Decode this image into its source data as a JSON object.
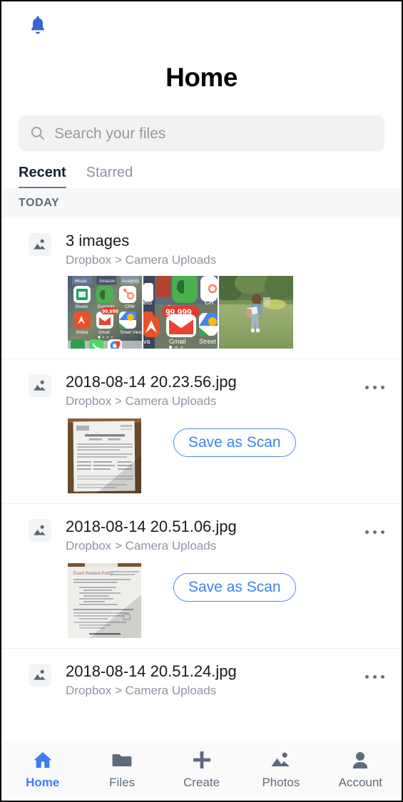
{
  "app": {
    "title": "Home",
    "accent_color": "#3d7df6",
    "muted_text_color": "#8d96a3",
    "section_bg_color": "#F6F8FA"
  },
  "topbar": {
    "notifications_icon": "bell-icon"
  },
  "search": {
    "placeholder": "Search your files",
    "value": "",
    "icon": "search-icon"
  },
  "tabs": [
    {
      "label": "Recent",
      "active": true
    },
    {
      "label": "Starred",
      "active": false
    }
  ],
  "sections": [
    {
      "header": "TODAY",
      "rows": [
        {
          "title": "3 images",
          "path": "Dropbox > Camera Uploads",
          "icon": "image-file-icon",
          "has_overflow": false,
          "thumbnails": [
            "phone-home-screen-screenshot",
            "phone-home-screen-zoom-screenshot",
            "person-standing-on-grass-photo"
          ],
          "action_label": null
        },
        {
          "title": "2018-08-14 20.23.56.jpg",
          "path": "Dropbox > Camera Uploads",
          "icon": "image-file-icon",
          "has_overflow": true,
          "thumbnails": [
            "document-form-on-wood-table-photo"
          ],
          "action_label": "Save as Scan"
        },
        {
          "title": "2018-08-14 20.51.06.jpg",
          "path": "Dropbox > Camera Uploads",
          "icon": "image-file-icon",
          "has_overflow": true,
          "thumbnails": [
            "document-page-photo"
          ],
          "action_label": "Save as Scan"
        },
        {
          "title": "2018-08-14 20.51.24.jpg",
          "path": "Dropbox > Camera Uploads",
          "icon": "image-file-icon",
          "has_overflow": true,
          "thumbnails": [],
          "action_label": null
        }
      ]
    }
  ],
  "bottom_nav": [
    {
      "label": "Home",
      "icon": "house-icon",
      "active": true
    },
    {
      "label": "Files",
      "icon": "folder-icon",
      "active": false
    },
    {
      "label": "Create",
      "icon": "plus-icon",
      "active": false
    },
    {
      "label": "Photos",
      "icon": "photos-icon",
      "active": false
    },
    {
      "label": "Account",
      "icon": "person-icon",
      "active": false
    }
  ]
}
